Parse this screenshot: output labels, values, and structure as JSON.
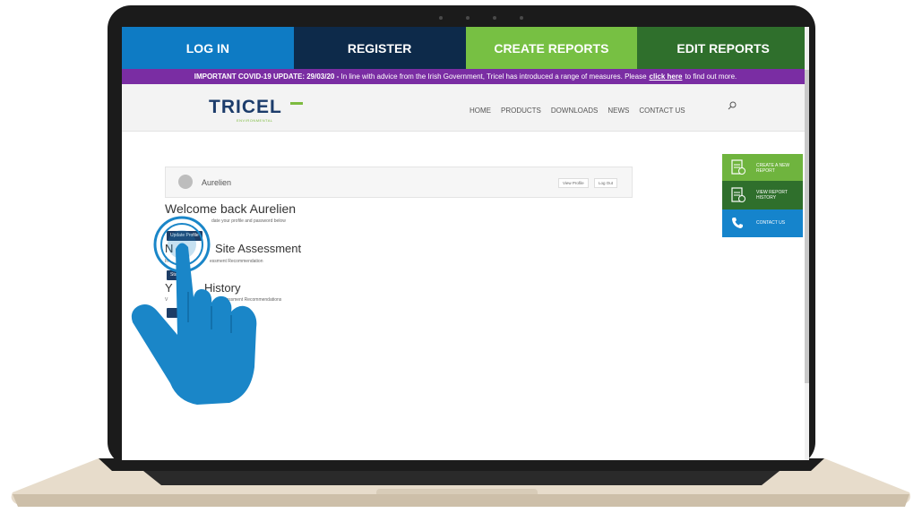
{
  "nav": {
    "login": "LOG IN",
    "register": "REGISTER",
    "create_reports": "CREATE REPORTS",
    "edit_reports": "EDIT REPORTS"
  },
  "covid": {
    "bold": "IMPORTANT COVID-19 UPDATE: 29/03/20 -",
    "text": "In line with advice from the Irish Government, Tricel has introduced a range of measures. Please",
    "link": "click here",
    "tail": "to find out more."
  },
  "header": {
    "logo": "TRICEL",
    "logo_sub": "ENVIRONMENTAL",
    "menu": [
      "HOME",
      "PRODUCTS",
      "DOWNLOADS",
      "NEWS",
      "CONTACT US"
    ]
  },
  "profile": {
    "username": "Aurelien",
    "view_profile": "View Profile",
    "log_out": "Log Out"
  },
  "content": {
    "welcome": "Welcome back Aurelien",
    "update_text": "date your profile and password below",
    "update_button": "Update Profile",
    "assessment_title_a": "N",
    "assessment_title_b": "Site Assessment",
    "assessment_text_a": "In",
    "assessment_text_b": "essment Recommendation",
    "assessment_button": "Start",
    "history_title_a": "Y",
    "history_title_b": "History",
    "history_text_a": "V",
    "history_text_b": "Assessment Recommendations"
  },
  "side": {
    "create": "CREATE A NEW REPORT",
    "history": "VIEW REPORT HISTORY",
    "contact": "CONTACT US"
  },
  "colors": {
    "login": "#0e7bc4",
    "register": "#0d2a4a",
    "create": "#77c043",
    "edit": "#2f6f2c",
    "covid": "#7a2da3",
    "hand": "#1a86c8"
  }
}
